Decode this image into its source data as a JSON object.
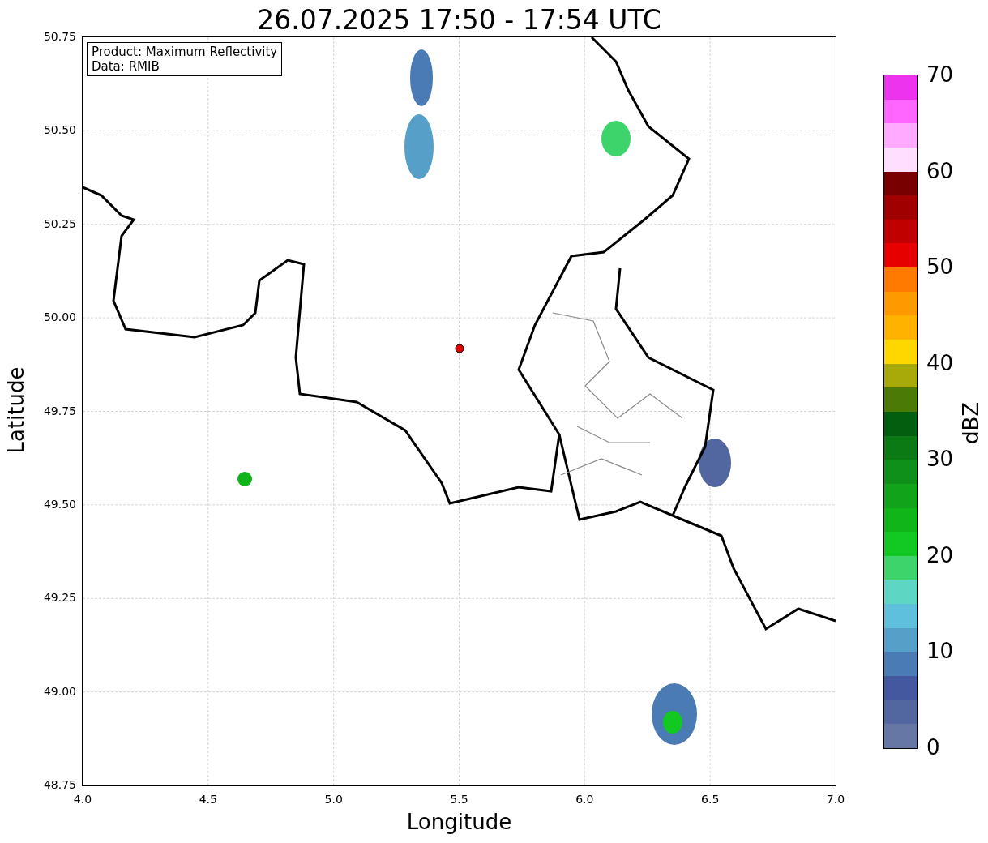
{
  "title": "26.07.2025 17:50 - 17:54 UTC",
  "legend": [
    "Product: Maximum Reflectivity",
    "Data: RMIB"
  ],
  "map": {
    "xlabel": "Longitude",
    "ylabel": "Latitude",
    "xticks": [
      "4.0",
      "4.5",
      "5.0",
      "5.5",
      "6.0",
      "6.5",
      "7.0"
    ],
    "yticks": [
      "50.75",
      "50.50",
      "50.25",
      "50.00",
      "49.75",
      "49.50",
      "49.25",
      "49.00",
      "48.75"
    ]
  },
  "colorbar": {
    "label": "dBZ",
    "ticks": [
      "70",
      "60",
      "50",
      "40",
      "30",
      "20",
      "10",
      "0"
    ],
    "segments": [
      {
        "color": "#ee33ee"
      },
      {
        "color": "#ff66ff"
      },
      {
        "color": "#ffaaff"
      },
      {
        "color": "#ffdeff"
      },
      {
        "color": "#780000"
      },
      {
        "color": "#a00000"
      },
      {
        "color": "#c00000"
      },
      {
        "color": "#e60000"
      },
      {
        "color": "#ff7a00"
      },
      {
        "color": "#ff9900"
      },
      {
        "color": "#ffb300"
      },
      {
        "color": "#ffd700"
      },
      {
        "color": "#a8aa0a"
      },
      {
        "color": "#4b7a07"
      },
      {
        "color": "#045e10"
      },
      {
        "color": "#0b7a14"
      },
      {
        "color": "#0e901a"
      },
      {
        "color": "#11a31a"
      },
      {
        "color": "#10b51a"
      },
      {
        "color": "#12c822"
      },
      {
        "color": "#3ed46c"
      },
      {
        "color": "#5dd6c4"
      },
      {
        "color": "#5ec0dd"
      },
      {
        "color": "#559fc8"
      },
      {
        "color": "#4a7bb4"
      },
      {
        "color": "#4458a0"
      },
      {
        "color": "#52679f"
      },
      {
        "color": "#6677a5"
      }
    ]
  }
}
